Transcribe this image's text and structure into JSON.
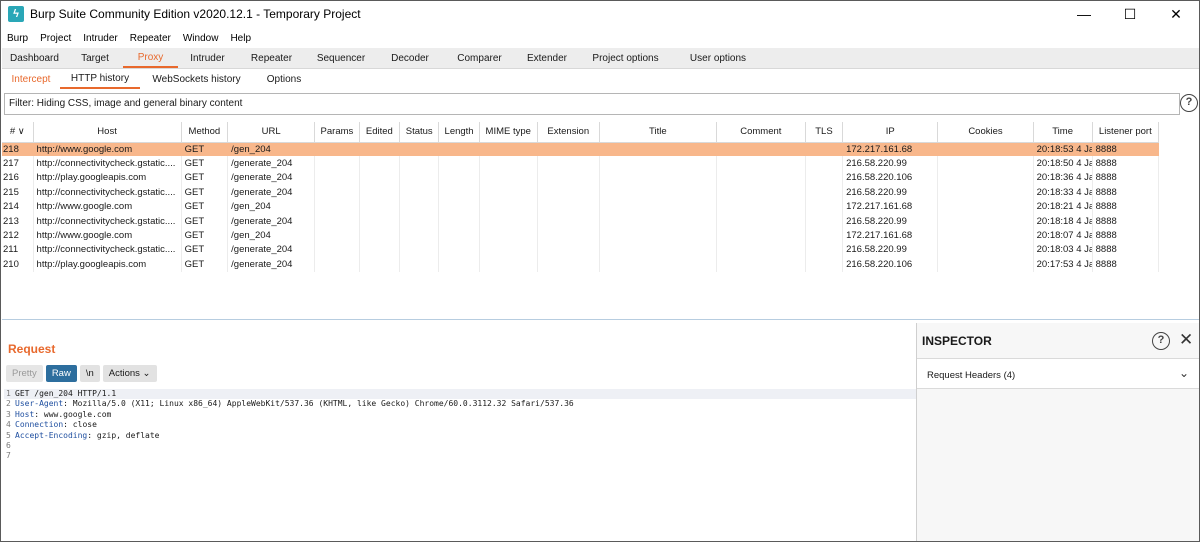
{
  "window": {
    "title": "Burp Suite Community Edition v2020.12.1 - Temporary Project",
    "icon": "burp-lightning-icon",
    "minimize": "—",
    "maximize": "☐",
    "close": "✕"
  },
  "menu": [
    "Burp",
    "Project",
    "Intruder",
    "Repeater",
    "Window",
    "Help"
  ],
  "main_tabs": [
    "Dashboard",
    "Target",
    "Proxy",
    "Intruder",
    "Repeater",
    "Sequencer",
    "Decoder",
    "Comparer",
    "Extender",
    "Project options",
    "User options"
  ],
  "active_main_tab": "Proxy",
  "sub_tabs": [
    "Intercept",
    "HTTP history",
    "WebSockets history",
    "Options"
  ],
  "active_sub_tab": "HTTP history",
  "filter": {
    "text": "Filter: Hiding CSS, image and general binary content",
    "help": "?"
  },
  "table": {
    "columns": [
      "# ∨",
      "Host",
      "Method",
      "URL",
      "Params",
      "Edited",
      "Status",
      "Length",
      "MIME type",
      "Extension",
      "Title",
      "Comment",
      "TLS",
      "IP",
      "Cookies",
      "Time",
      "Listener port"
    ],
    "rows": [
      [
        "218",
        "http://www.google.com",
        "GET",
        "/gen_204",
        "",
        "",
        "",
        "",
        "",
        "",
        "",
        "",
        "",
        "172.217.161.68",
        "",
        "20:18:53 4 Jan...",
        "8888"
      ],
      [
        "217",
        "http://connectivitycheck.gstatic....",
        "GET",
        "/generate_204",
        "",
        "",
        "",
        "",
        "",
        "",
        "",
        "",
        "",
        "216.58.220.99",
        "",
        "20:18:50 4 Jan...",
        "8888"
      ],
      [
        "216",
        "http://play.googleapis.com",
        "GET",
        "/generate_204",
        "",
        "",
        "",
        "",
        "",
        "",
        "",
        "",
        "",
        "216.58.220.106",
        "",
        "20:18:36 4 Jan...",
        "8888"
      ],
      [
        "215",
        "http://connectivitycheck.gstatic....",
        "GET",
        "/generate_204",
        "",
        "",
        "",
        "",
        "",
        "",
        "",
        "",
        "",
        "216.58.220.99",
        "",
        "20:18:33 4 Jan...",
        "8888"
      ],
      [
        "214",
        "http://www.google.com",
        "GET",
        "/gen_204",
        "",
        "",
        "",
        "",
        "",
        "",
        "",
        "",
        "",
        "172.217.161.68",
        "",
        "20:18:21 4 Jan...",
        "8888"
      ],
      [
        "213",
        "http://connectivitycheck.gstatic....",
        "GET",
        "/generate_204",
        "",
        "",
        "",
        "",
        "",
        "",
        "",
        "",
        "",
        "216.58.220.99",
        "",
        "20:18:18 4 Jan...",
        "8888"
      ],
      [
        "212",
        "http://www.google.com",
        "GET",
        "/gen_204",
        "",
        "",
        "",
        "",
        "",
        "",
        "",
        "",
        "",
        "172.217.161.68",
        "",
        "20:18:07 4 Jan...",
        "8888"
      ],
      [
        "211",
        "http://connectivitycheck.gstatic....",
        "GET",
        "/generate_204",
        "",
        "",
        "",
        "",
        "",
        "",
        "",
        "",
        "",
        "216.58.220.99",
        "",
        "20:18:03 4 Jan...",
        "8888"
      ],
      [
        "210",
        "http://play.googleapis.com",
        "GET",
        "/generate_204",
        "",
        "",
        "",
        "",
        "",
        "",
        "",
        "",
        "",
        "216.58.220.106",
        "",
        "20:17:53 4 Jan...",
        "8888"
      ]
    ],
    "selected_row": "218"
  },
  "request": {
    "title": "Request",
    "buttons": [
      "Pretty",
      "Raw",
      "\\n",
      "Actions ⌄"
    ],
    "active_button": "Raw",
    "lines": [
      {
        "num": "1",
        "name": "",
        "value": "GET /gen_204 HTTP/1.1"
      },
      {
        "num": "2",
        "name": "User-Agent",
        "value": ": Mozilla/5.0 (X11; Linux x86_64) AppleWebKit/537.36 (KHTML, like Gecko) Chrome/60.0.3112.32 Safari/537.36"
      },
      {
        "num": "3",
        "name": "Host",
        "value": ": www.google.com"
      },
      {
        "num": "4",
        "name": "Connection",
        "value": ": close"
      },
      {
        "num": "5",
        "name": "Accept-Encoding",
        "value": ": gzip, deflate"
      },
      {
        "num": "6",
        "name": "",
        "value": ""
      },
      {
        "num": "7",
        "name": "",
        "value": ""
      }
    ]
  },
  "inspector": {
    "title": "INSPECTOR",
    "help": "?",
    "close": "✕",
    "section": "Request Headers (4)",
    "chevron": "⌄"
  },
  "colors": {
    "accent": "#e8692d",
    "selected_row": "#f8b78b",
    "raw_button": "#2d6e9e",
    "header_name": "#1f4fa0"
  }
}
